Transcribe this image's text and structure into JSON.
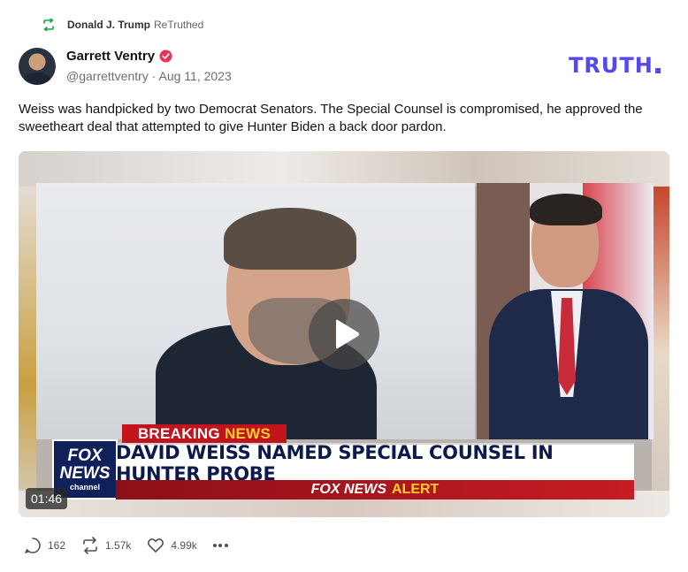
{
  "retruth": {
    "icon": "retruth-icon",
    "user": "Donald J. Trump",
    "label": "ReTruthed"
  },
  "author": {
    "name": "Garrett Ventry",
    "verified_icon": "verified-badge-icon",
    "handle": "@garrettventry",
    "separator": "·",
    "date": "Aug 11, 2023",
    "avatar": "avatar"
  },
  "brand": {
    "logo_text": "TRUTH",
    "color": "#5448ee"
  },
  "post": {
    "text": "Weiss was handpicked by two Democrat Senators. The Special Counsel is compromised, he approved the sweetheart deal that attempted to give Hunter Biden a back door pardon."
  },
  "video": {
    "duration": "01:46",
    "breaking_prefix": "BREAKING",
    "breaking_suffix": "NEWS",
    "headline": "DAVID WEISS NAMED SPECIAL COUNSEL IN HUNTER PROBE",
    "alert_prefix": "FOX NEWS",
    "alert_suffix": "ALERT",
    "network_logo_top": "FOX",
    "network_logo_bottom": "NEWS",
    "network_logo_sub": "channel",
    "play_icon": "play-icon"
  },
  "actions": {
    "replies": {
      "icon": "reply-icon",
      "count": "162"
    },
    "retruths": {
      "icon": "retruth-icon",
      "count": "1.57k"
    },
    "likes": {
      "icon": "heart-icon",
      "count": "4.99k"
    },
    "more_icon": "more-icon"
  },
  "colors": {
    "accent": "#5448ee",
    "retruth_green": "#17a34a",
    "verified_pink": "#e8345a"
  }
}
